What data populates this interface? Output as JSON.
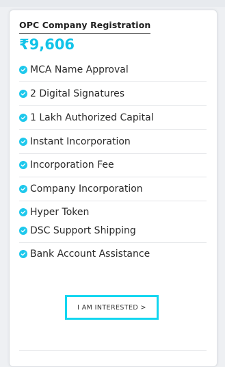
{
  "card": {
    "title": "OPC Company  Registration",
    "price": "₹9,606",
    "features": [
      {
        "label": "MCA Name Approval"
      },
      {
        "label": "2 Digital Signatures"
      },
      {
        "label": "1 Lakh Authorized Capital"
      },
      {
        "label": "Instant Incorporation"
      },
      {
        "label": "Incorporation Fee"
      },
      {
        "label": "Company Incorporation"
      },
      {
        "label": "Hyper Token"
      },
      {
        "label": "DSC Support Shipping"
      },
      {
        "label": "Bank Account Assistance"
      }
    ],
    "cta_label": "I AM INTERESTED >"
  },
  "icons": {
    "feature_check": "check-circle-icon"
  },
  "colors": {
    "accent": "#12c3e8",
    "check": "#1ec8ec",
    "cta_border": "#12d6f0"
  }
}
